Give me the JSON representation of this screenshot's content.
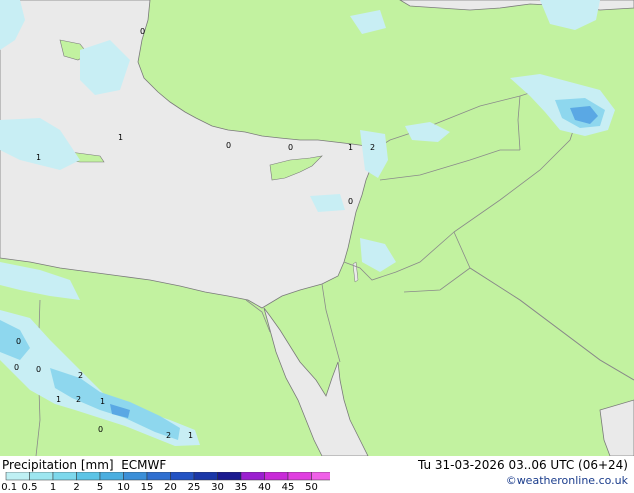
{
  "footer": {
    "title": "Precipitation [mm]",
    "model": "ECMWF",
    "valid_time": "Tu 31-03-2026 03..06 UTC (06+24)",
    "credit": "©weatheronline.co.uk"
  },
  "legend": {
    "ticks": [
      "0.1",
      "0.5",
      "1",
      "2",
      "5",
      "10",
      "15",
      "20",
      "25",
      "30",
      "35",
      "40",
      "45",
      "50"
    ],
    "colors": [
      "#bff0f4",
      "#9de6f0",
      "#7dd8ec",
      "#5cc4e6",
      "#4aaee0",
      "#3b8fd8",
      "#2f6fd0",
      "#2353c4",
      "#1a37a8",
      "#1a1a90",
      "#9b1fd0",
      "#c82ad8",
      "#e03ee0",
      "#f060e8"
    ]
  },
  "map": {
    "colors": {
      "land": "#c2f2a0",
      "sea": "#eaeaea",
      "border": "#8a8a8a",
      "coast": "#7a7a7a",
      "precip_light": "#c8eef4",
      "precip_mid": "#8ed7ee",
      "precip_heavy": "#5aa8e4"
    },
    "labels": [
      "0",
      "1",
      "2",
      "2",
      "1",
      "1",
      "2",
      "1",
      "0",
      "0",
      "0",
      "0",
      "0",
      "0",
      "1",
      "2",
      "1",
      "0"
    ]
  }
}
